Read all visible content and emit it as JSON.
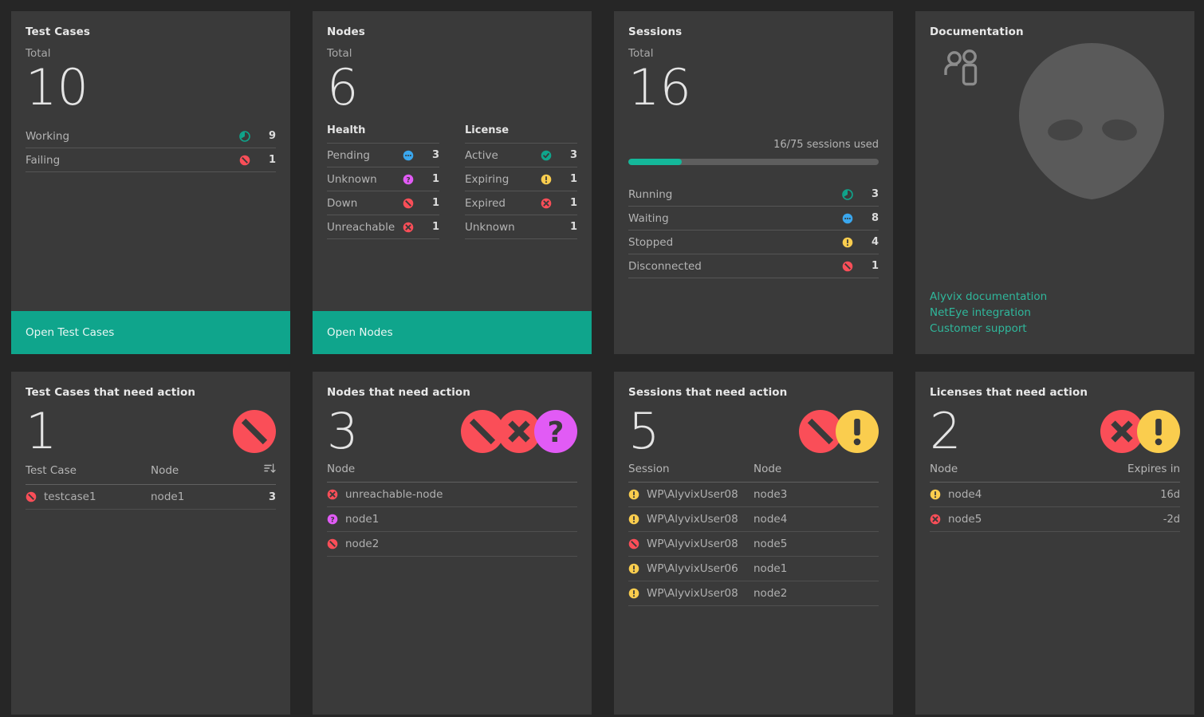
{
  "theme": {
    "page_bg": "#262626",
    "card_bg": "#3a3a3a",
    "accent_teal": "#0fa58c",
    "status_red": "#fa4e58",
    "status_yellow": "#facd4e",
    "status_magenta": "#e15bf5",
    "status_blue": "#3aa7ee",
    "status_green": "#0fa58c",
    "link_teal": "#2fb89c"
  },
  "cards": {
    "test_cases": {
      "title": "Test Cases",
      "total_label": "Total",
      "total": "10",
      "stats": [
        {
          "name": "Working",
          "icon": "pie-teal-icon",
          "value": "9"
        },
        {
          "name": "Failing",
          "icon": "slash-red-icon",
          "value": "1"
        }
      ],
      "button": "Open Test Cases"
    },
    "nodes": {
      "title": "Nodes",
      "total_label": "Total",
      "total": "6",
      "health_header": "Health",
      "health": [
        {
          "name": "Pending",
          "icon": "dots-blue-icon",
          "value": "3"
        },
        {
          "name": "Unknown",
          "icon": "question-magenta-icon",
          "value": "1"
        },
        {
          "name": "Down",
          "icon": "slash-red-icon",
          "value": "1"
        },
        {
          "name": "Unreachable",
          "icon": "cross-red-icon",
          "value": "1"
        }
      ],
      "license_header": "License",
      "license": [
        {
          "name": "Active",
          "icon": "check-teal-icon",
          "value": "3"
        },
        {
          "name": "Expiring",
          "icon": "warning-yellow-icon",
          "value": "1"
        },
        {
          "name": "Expired",
          "icon": "cross-red-icon",
          "value": "1"
        },
        {
          "name": "Unknown",
          "icon": "none",
          "value": "1"
        }
      ],
      "button": "Open Nodes"
    },
    "sessions": {
      "title": "Sessions",
      "total_label": "Total",
      "total": "16",
      "usage_text": "16/75 sessions used",
      "usage_percent": 21.3,
      "stats": [
        {
          "name": "Running",
          "icon": "pie-teal-icon",
          "value": "3"
        },
        {
          "name": "Waiting",
          "icon": "dots-blue-icon",
          "value": "8"
        },
        {
          "name": "Stopped",
          "icon": "warning-yellow-icon",
          "value": "4"
        },
        {
          "name": "Disconnected",
          "icon": "slash-red-icon",
          "value": "1"
        }
      ]
    },
    "documentation": {
      "title": "Documentation",
      "icons": [
        "people-icon",
        "alien-head-icon"
      ],
      "links": [
        "Alyvix documentation",
        "NetEye integration",
        "Customer support"
      ]
    },
    "test_cases_action": {
      "title": "Test Cases that need action",
      "count": "1",
      "badges": [
        "slash-red-badge"
      ],
      "columns": [
        "Test Case",
        "Node",
        "sort-desc-icon"
      ],
      "rows": [
        {
          "icon": "slash-red-icon",
          "test_case": "testcase1",
          "node": "node1",
          "count": "3"
        }
      ]
    },
    "nodes_action": {
      "title": "Nodes that need action",
      "count": "3",
      "badges": [
        "slash-red-badge",
        "cross-red-badge",
        "question-magenta-badge"
      ],
      "columns": [
        "Node"
      ],
      "rows": [
        {
          "icon": "cross-red-icon",
          "node": "unreachable-node"
        },
        {
          "icon": "question-magenta-icon",
          "node": "node1"
        },
        {
          "icon": "slash-red-icon",
          "node": "node2"
        }
      ]
    },
    "sessions_action": {
      "title": "Sessions that need action",
      "count": "5",
      "badges": [
        "slash-red-badge",
        "warning-yellow-badge"
      ],
      "columns": [
        "Session",
        "Node"
      ],
      "rows": [
        {
          "icon": "warning-yellow-icon",
          "session": "WP\\AlyvixUser08",
          "node": "node3"
        },
        {
          "icon": "warning-yellow-icon",
          "session": "WP\\AlyvixUser08",
          "node": "node4"
        },
        {
          "icon": "slash-red-icon",
          "session": "WP\\AlyvixUser08",
          "node": "node5"
        },
        {
          "icon": "warning-yellow-icon",
          "session": "WP\\AlyvixUser06",
          "node": "node1"
        },
        {
          "icon": "warning-yellow-icon",
          "session": "WP\\AlyvixUser08",
          "node": "node2"
        }
      ]
    },
    "licenses_action": {
      "title": "Licenses that need action",
      "count": "2",
      "badges": [
        "cross-red-badge",
        "warning-yellow-badge"
      ],
      "columns": [
        "Node",
        "Expires in"
      ],
      "rows": [
        {
          "icon": "warning-yellow-icon",
          "node": "node4",
          "expires": "16d"
        },
        {
          "icon": "cross-red-icon",
          "node": "node5",
          "expires": "-2d"
        }
      ]
    }
  }
}
